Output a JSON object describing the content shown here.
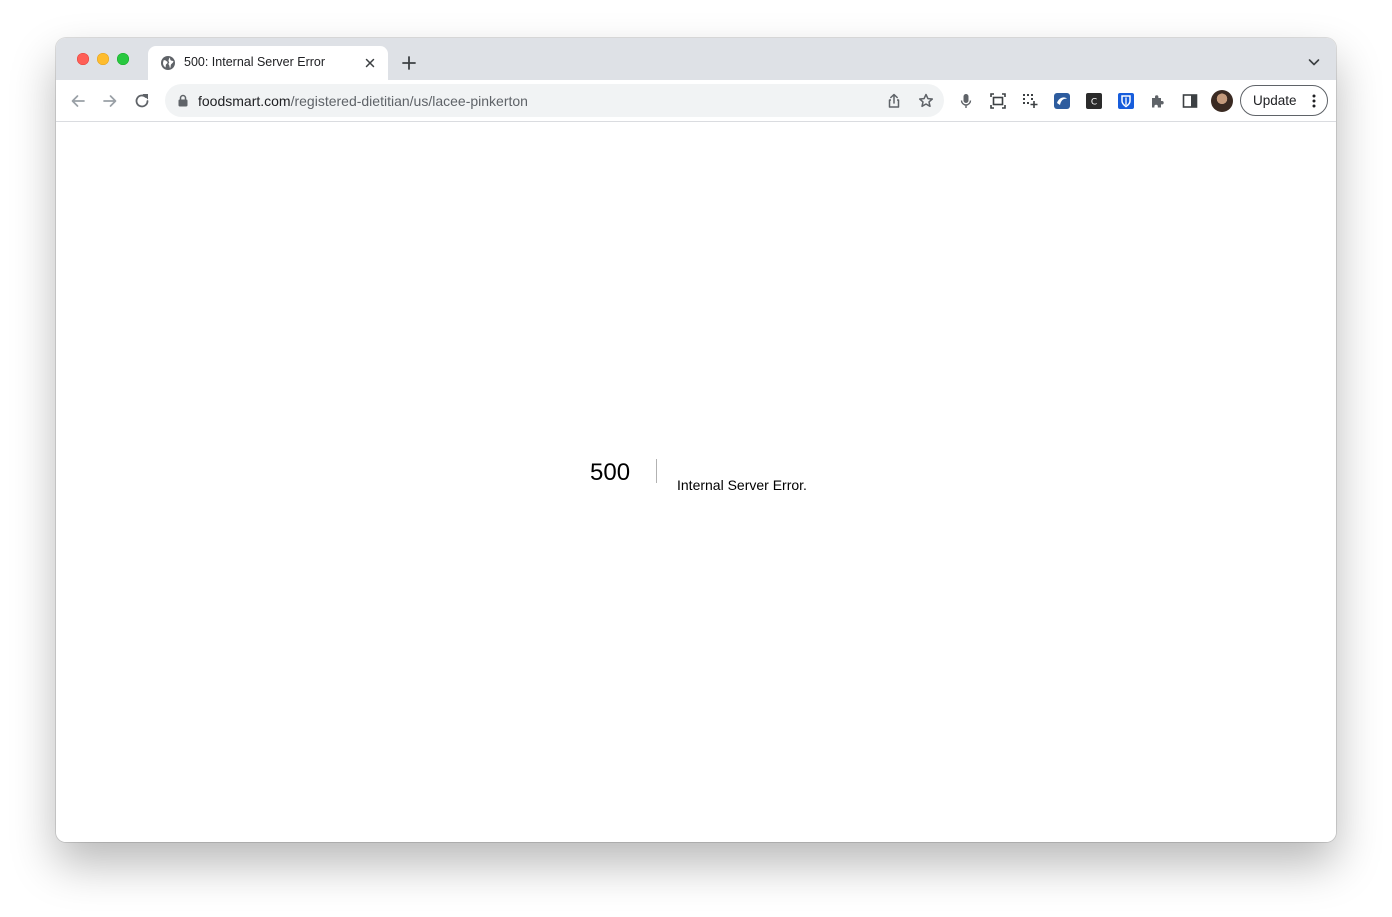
{
  "browser": {
    "tab": {
      "title": "500: Internal Server Error",
      "favicon": "globe-icon"
    },
    "address_bar": {
      "domain": "foodsmart.com",
      "path": "/registered-dietitian/us/lacee-pinkerton"
    },
    "update_button": {
      "label": "Update"
    },
    "extensions": [
      "screenshot-icon",
      "grid-select-icon",
      "blue-extension-icon",
      "c-extension-icon",
      "bitwarden-shield-icon",
      "puzzle-icon",
      "side-panel-icon"
    ]
  },
  "page": {
    "error_code": "500",
    "error_message": "Internal Server Error."
  },
  "colors": {
    "tabstrip": "#dee1e6",
    "omnibox": "#f1f3f4",
    "traffic_red": "#ff5f57",
    "traffic_yellow": "#febc2e",
    "traffic_green": "#28c840"
  }
}
